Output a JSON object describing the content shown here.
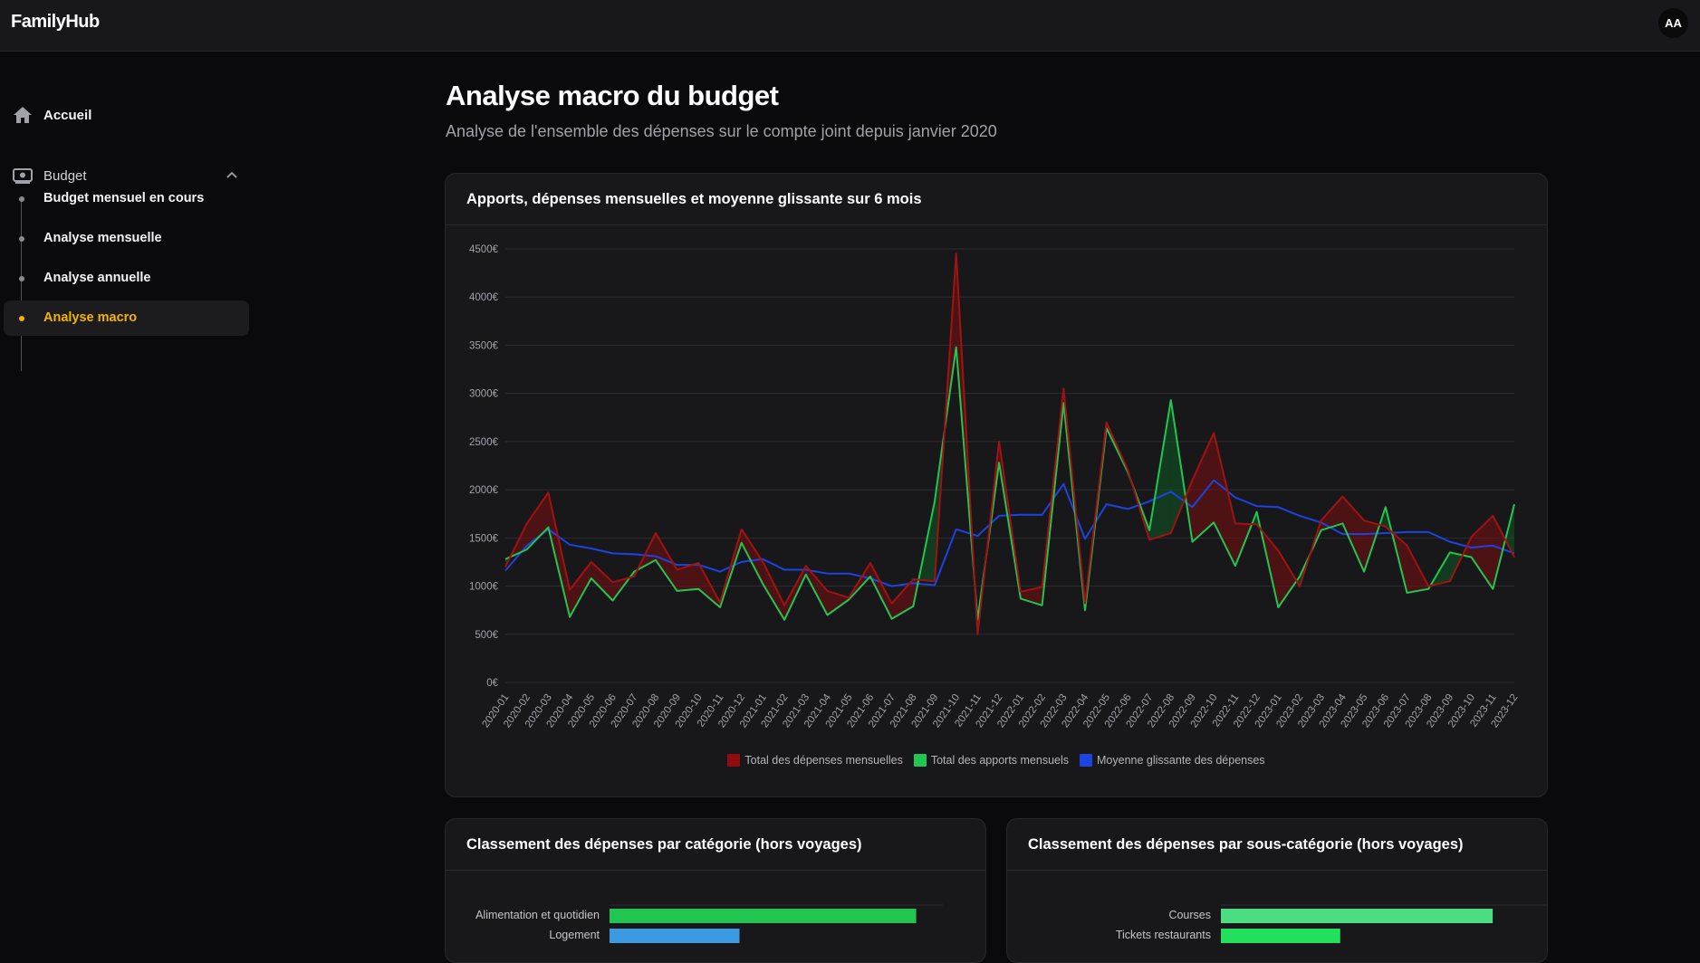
{
  "app": {
    "brand": "FamilyHub",
    "avatar_initials": "AA"
  },
  "sidebar": {
    "home_label": "Accueil",
    "group_label": "Budget",
    "sub_items": [
      {
        "label": "Budget mensuel en cours",
        "active": false
      },
      {
        "label": "Analyse mensuelle",
        "active": false
      },
      {
        "label": "Analyse annuelle",
        "active": false
      },
      {
        "label": "Analyse macro",
        "active": true
      }
    ]
  },
  "page": {
    "title": "Analyse macro du budget",
    "subtitle": "Analyse de l'ensemble des dépenses sur le compte joint depuis janvier 2020"
  },
  "colors": {
    "accent": "#f5b301",
    "expenses": "#8f0d0d",
    "income": "#23c552",
    "average": "#1d43e0"
  },
  "chart_card": {
    "title": "Apports, dépenses mensuelles et moyenne glissante sur 6 mois"
  },
  "chart_data": {
    "type": "line",
    "title": "Apports, dépenses mensuelles et moyenne glissante sur 6 mois",
    "ylim": [
      0,
      4500
    ],
    "y_ticks": [
      "4500€",
      "4000€",
      "3500€",
      "3000€",
      "2500€",
      "2000€",
      "1500€",
      "1000€",
      "500€",
      "0€"
    ],
    "grid": true,
    "legend_placement": "bottom",
    "x": [
      "2020-01",
      "2020-02",
      "2020-03",
      "2020-04",
      "2020-05",
      "2020-06",
      "2020-07",
      "2020-08",
      "2020-09",
      "2020-10",
      "2020-11",
      "2020-12",
      "2021-01",
      "2021-02",
      "2021-03",
      "2021-04",
      "2021-05",
      "2021-06",
      "2021-07",
      "2021-08",
      "2021-09",
      "2021-10",
      "2021-11",
      "2021-12",
      "2022-01",
      "2022-02",
      "2022-03",
      "2022-04",
      "2022-05",
      "2022-06",
      "2022-07",
      "2022-08",
      "2022-09",
      "2022-10",
      "2022-11",
      "2022-12",
      "2023-01",
      "2023-02",
      "2023-03",
      "2023-04",
      "2023-05",
      "2023-06",
      "2023-07",
      "2023-08",
      "2023-09",
      "2023-10",
      "2023-11",
      "2023-12"
    ],
    "series": [
      {
        "name": "Total des dépenses mensuelles",
        "color": "#8f0d0d",
        "values": [
          1200,
          1650,
          1970,
          960,
          1250,
          1040,
          1100,
          1550,
          1170,
          1240,
          830,
          1590,
          1250,
          800,
          1210,
          950,
          880,
          1240,
          820,
          1070,
          1050,
          4450,
          500,
          2500,
          940,
          990,
          3050,
          820,
          2700,
          2200,
          1480,
          1550,
          2100,
          2590,
          1650,
          1640,
          1370,
          1000,
          1680,
          1930,
          1680,
          1620,
          1420,
          1000,
          1050,
          1510,
          1730,
          1300
        ]
      },
      {
        "name": "Total des apports mensuels",
        "color": "#23c552",
        "values": [
          1280,
          1380,
          1610,
          680,
          1080,
          850,
          1150,
          1270,
          950,
          970,
          780,
          1450,
          1020,
          650,
          1120,
          700,
          860,
          1100,
          660,
          790,
          1880,
          3480,
          650,
          2280,
          870,
          800,
          2900,
          750,
          2640,
          2180,
          1580,
          2930,
          1460,
          1660,
          1210,
          1770,
          780,
          1100,
          1580,
          1650,
          1150,
          1820,
          930,
          970,
          1350,
          1300,
          970,
          1850
        ]
      },
      {
        "name": "Moyenne glissante des dépenses",
        "color": "#1d43e0",
        "values": [
          1160,
          1420,
          1590,
          1430,
          1390,
          1340,
          1330,
          1310,
          1220,
          1220,
          1150,
          1250,
          1280,
          1170,
          1170,
          1130,
          1130,
          1080,
          1000,
          1030,
          1010,
          1590,
          1520,
          1730,
          1740,
          1740,
          2060,
          1490,
          1850,
          1800,
          1880,
          1980,
          1820,
          2100,
          1920,
          1830,
          1820,
          1730,
          1660,
          1540,
          1540,
          1550,
          1560,
          1560,
          1460,
          1400,
          1420,
          1340
        ]
      }
    ]
  },
  "bottom_left": {
    "title": "Classement des dépenses par catégorie (hors voyages)",
    "bars": [
      {
        "label": "Alimentation et quotidien",
        "value": 0.92,
        "color": "#23c552"
      },
      {
        "label": "Logement",
        "value": 0.39,
        "color": "#3b9ae0"
      }
    ]
  },
  "bottom_right": {
    "title": "Classement des dépenses par sous-catégorie (hors voyages)",
    "bars": [
      {
        "label": "Courses",
        "value": 0.82,
        "color": "#4ade80"
      },
      {
        "label": "Tickets restaurants",
        "value": 0.36,
        "color": "#22e05e"
      }
    ]
  }
}
